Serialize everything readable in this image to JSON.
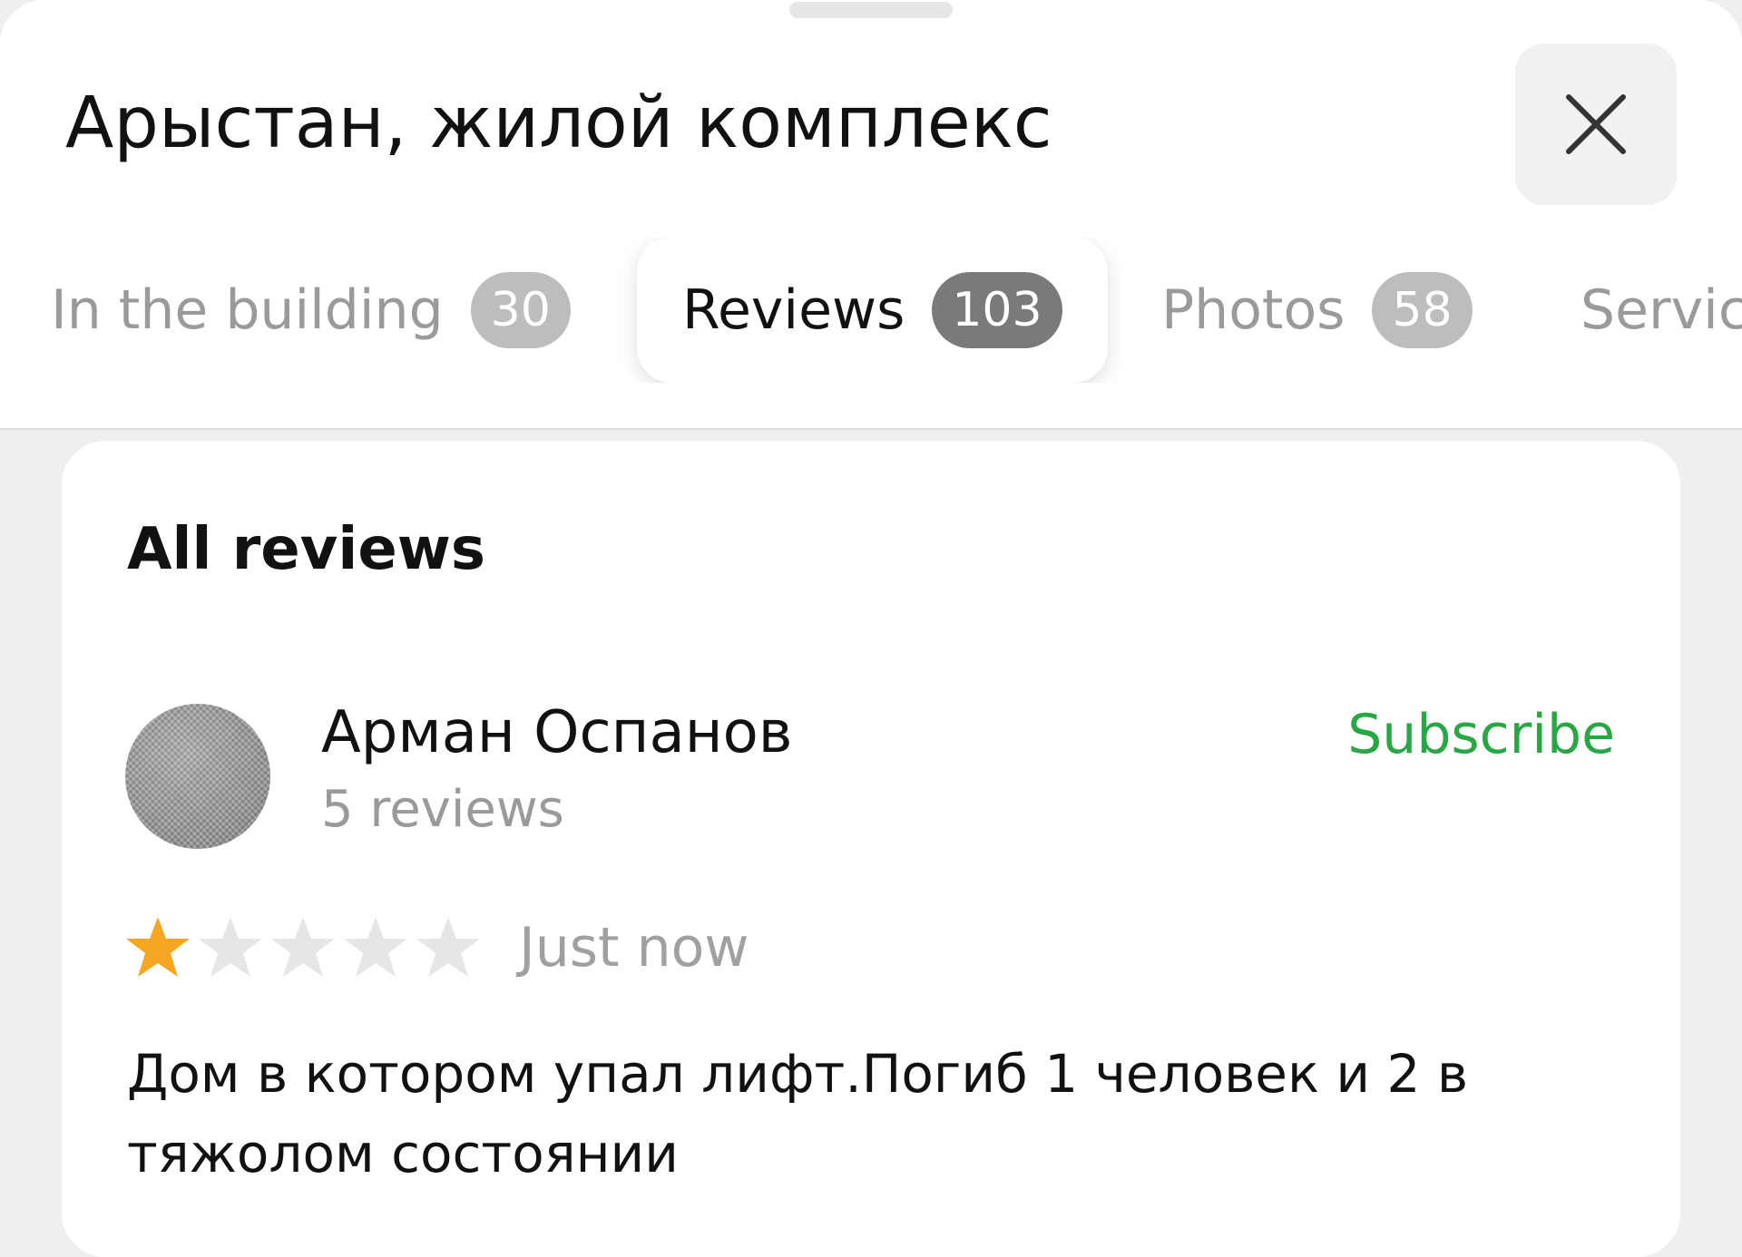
{
  "header": {
    "title": "Арыстан, жилой комплекс",
    "close_icon": "close-icon"
  },
  "tabs": [
    {
      "label": "In the building",
      "count": "30",
      "active": false
    },
    {
      "label": "Reviews",
      "count": "103",
      "active": true
    },
    {
      "label": "Photos",
      "count": "58",
      "active": false
    },
    {
      "label": "Servic",
      "count": "",
      "active": false
    }
  ],
  "reviews_section": {
    "title": "All reviews",
    "items": [
      {
        "author": "Арман Оспанов",
        "author_reviews": "5 reviews",
        "subscribe_label": "Subscribe",
        "rating": 1,
        "rating_max": 5,
        "time": "Just now",
        "text": "Дом в котором упал лифт.Погиб 1 человек и 2 в тяжолом состоянии"
      }
    ]
  },
  "colors": {
    "accent_green": "#28a745",
    "star_filled": "#f5a623",
    "star_empty": "#e6e6e6",
    "background": "#efefef"
  }
}
